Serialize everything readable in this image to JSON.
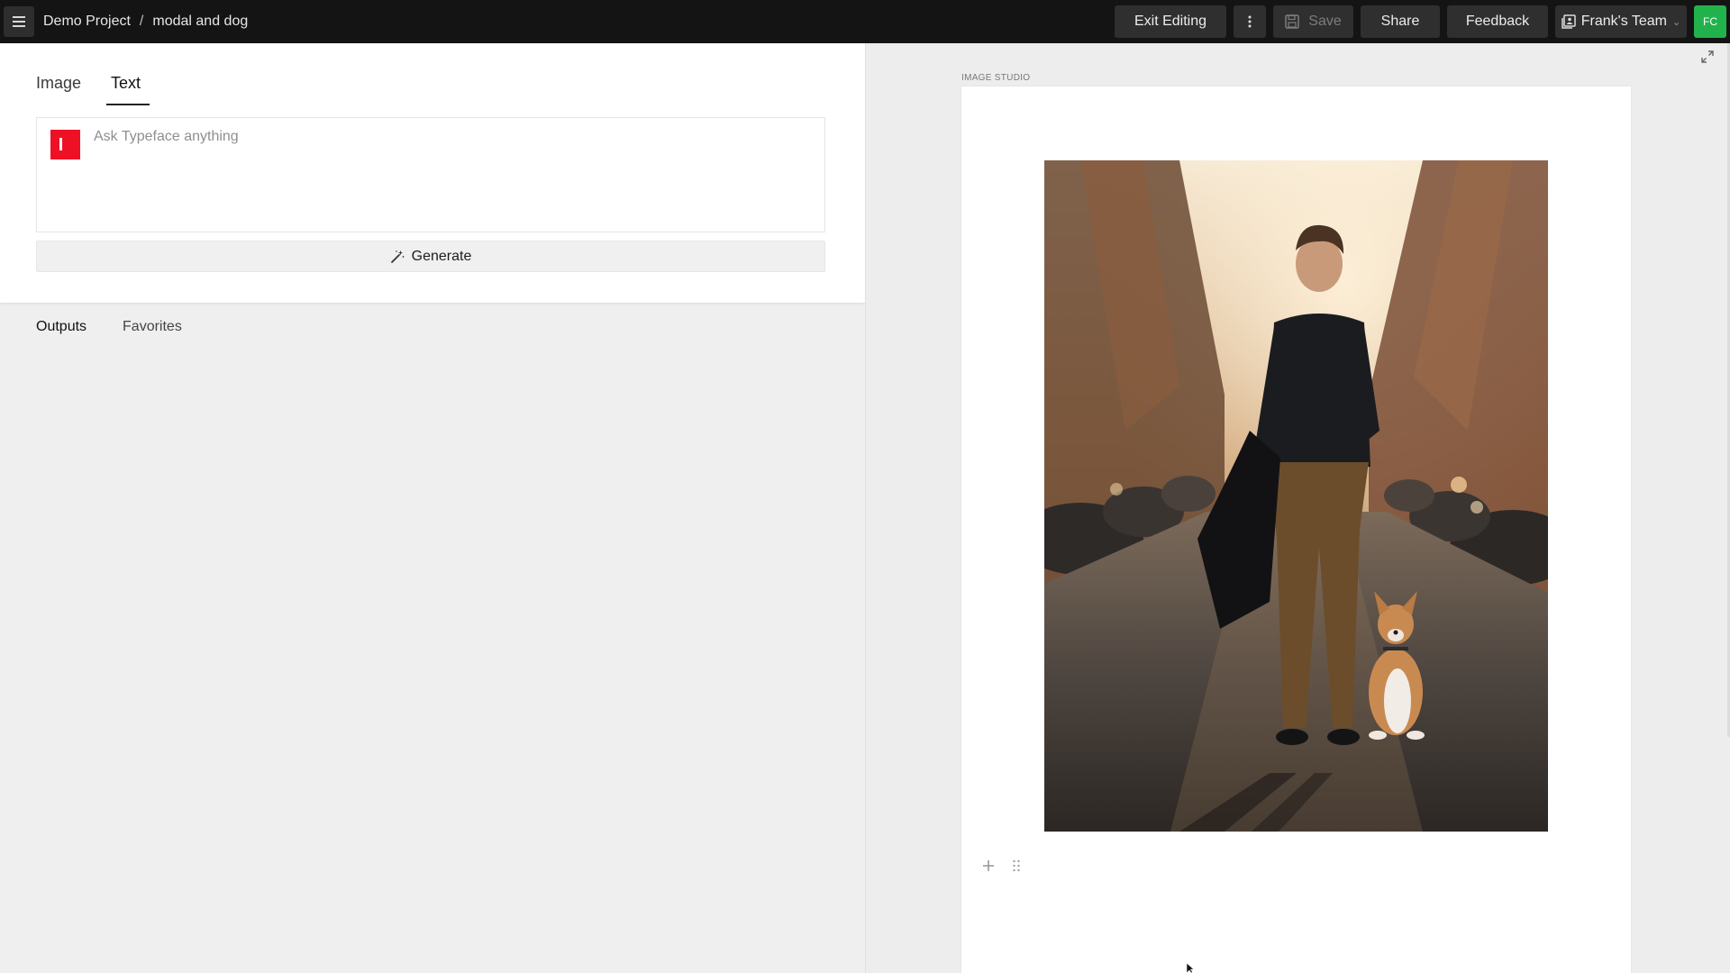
{
  "breadcrumb": {
    "project": "Demo Project",
    "separator": "/",
    "document": "modal and dog"
  },
  "toolbar": {
    "exit_label": "Exit Editing",
    "save_label": "Save",
    "share_label": "Share",
    "feedback_label": "Feedback",
    "team_label": "Frank's Team",
    "avatar_initials": "FC"
  },
  "compose": {
    "tabs": [
      {
        "label": "Image",
        "active": false
      },
      {
        "label": "Text",
        "active": true
      }
    ],
    "prompt_placeholder": "Ask Typeface anything",
    "prompt_value": "",
    "generate_label": "Generate"
  },
  "outputs": {
    "tabs": [
      {
        "label": "Outputs",
        "active": true
      },
      {
        "label": "Favorites",
        "active": false
      }
    ]
  },
  "studio": {
    "label": "IMAGE STUDIO"
  },
  "colors": {
    "topbar": "#141414",
    "brand_red": "#ee1126",
    "avatar_green": "#22b24c"
  },
  "icons": {
    "menu": "hamburger-icon",
    "more": "vertical-dots-icon",
    "save": "floppy-disk-icon",
    "team": "workspace-icon",
    "generate": "magic-wand-icon",
    "expand": "expand-icon",
    "add": "plus-icon",
    "drag": "drag-handle-icon"
  }
}
